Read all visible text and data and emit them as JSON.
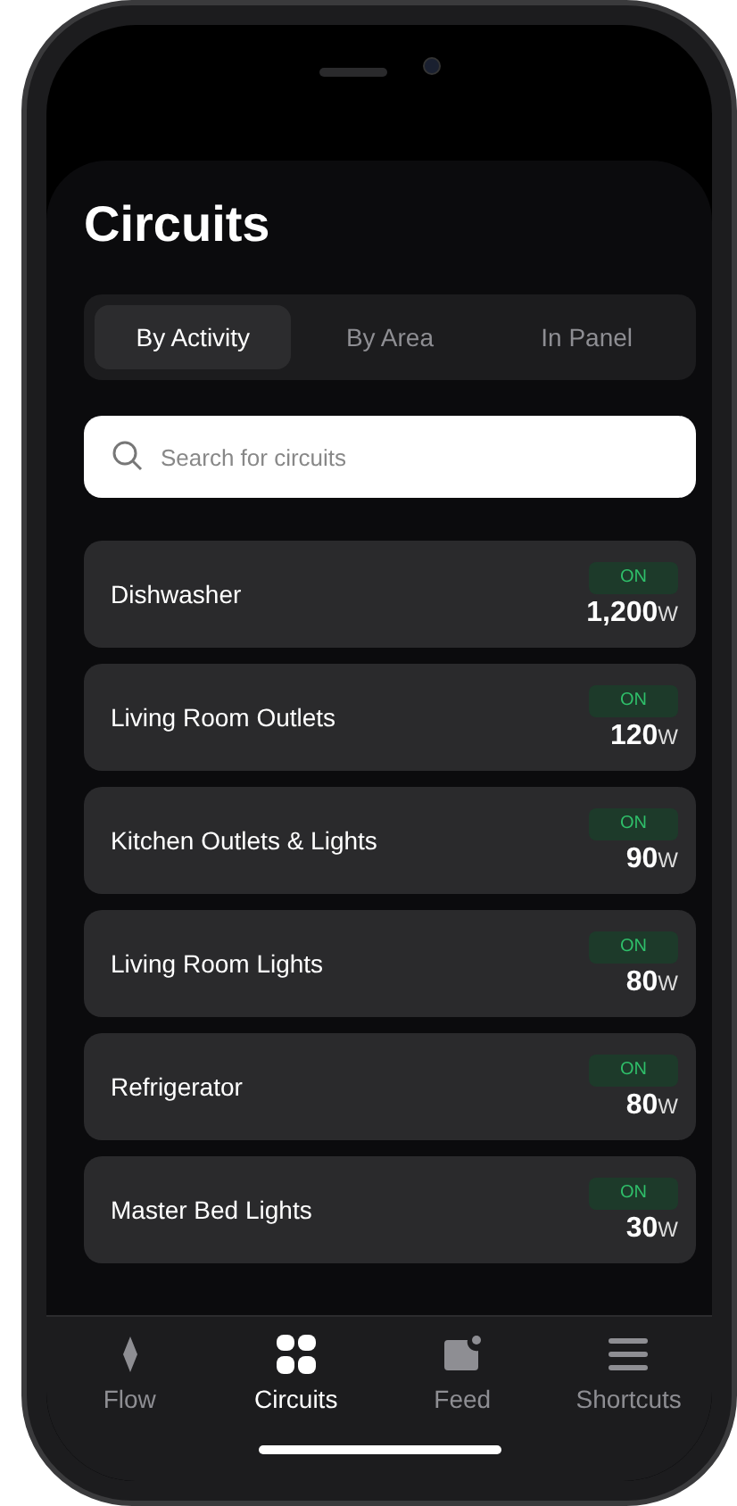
{
  "title": "Circuits",
  "tabs": [
    {
      "label": "By Activity",
      "selected": true
    },
    {
      "label": "By Area",
      "selected": false
    },
    {
      "label": "In Panel",
      "selected": false
    }
  ],
  "search": {
    "placeholder": "Search for circuits"
  },
  "circuits": [
    {
      "name": "Dishwasher",
      "status": "ON",
      "on": true,
      "power": "1,200",
      "unit": "W"
    },
    {
      "name": "Living Room Outlets",
      "status": "ON",
      "on": true,
      "power": "120",
      "unit": "W"
    },
    {
      "name": "Kitchen Outlets & Lights",
      "status": "ON",
      "on": true,
      "power": "90",
      "unit": "W"
    },
    {
      "name": "Living Room Lights",
      "status": "ON",
      "on": true,
      "power": "80",
      "unit": "W"
    },
    {
      "name": "Refrigerator",
      "status": "ON",
      "on": true,
      "power": "80",
      "unit": "W"
    },
    {
      "name": "Master Bed Lights",
      "status": "ON",
      "on": true,
      "power": "30",
      "unit": "W"
    }
  ],
  "nav": [
    {
      "kind": "flow",
      "label": "Flow",
      "selected": false
    },
    {
      "kind": "circuits",
      "label": "Circuits",
      "selected": true
    },
    {
      "kind": "feed",
      "label": "Feed",
      "selected": false
    },
    {
      "kind": "shortcuts",
      "label": "Shortcuts",
      "selected": false
    }
  ]
}
